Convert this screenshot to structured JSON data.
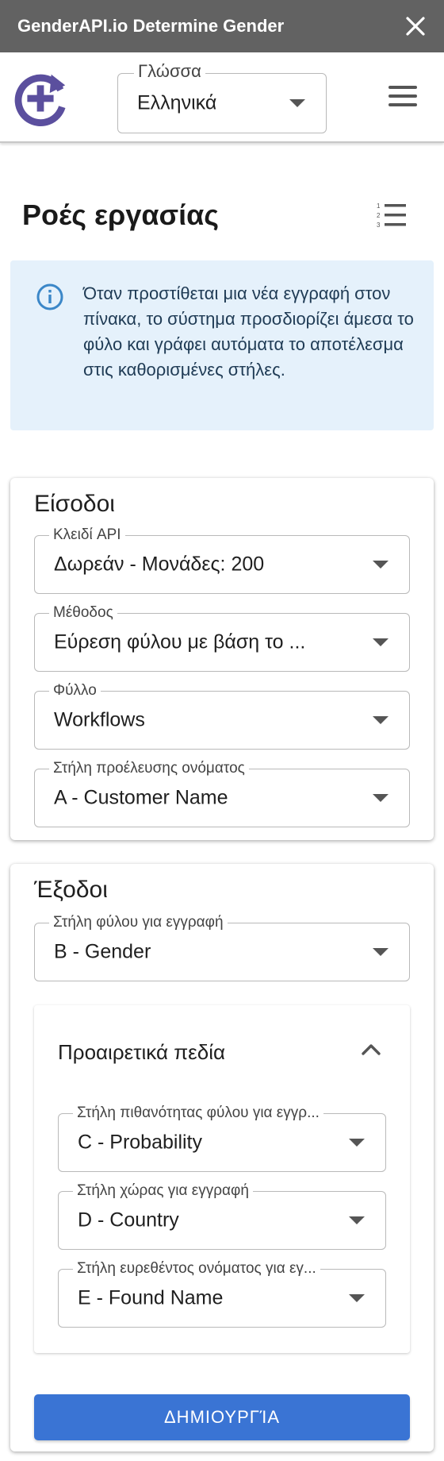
{
  "window": {
    "title": "GenderAPI.io Determine Gender"
  },
  "header": {
    "language_label": "Γλώσσα",
    "language_value": "Ελληνικά"
  },
  "page": {
    "title": "Ροές εργασίας"
  },
  "info": {
    "text": "Όταν προστίθεται μια νέα εγγραφή στον πίνακα, το σύστημα προσδιορίζει άμεσα το φύλο και γράφει αυτόματα το αποτέλεσμα στις καθορισμένες στήλες."
  },
  "inputs": {
    "title": "Είσοδοι",
    "api_key": {
      "label": "Κλειδί API",
      "value": "Δωρεάν - Μονάδες: 200"
    },
    "method": {
      "label": "Μέθοδος",
      "value": "Εύρεση φύλου με βάση το ..."
    },
    "sheet": {
      "label": "Φύλλο",
      "value": "Workflows"
    },
    "name_column": {
      "label": "Στήλη προέλευσης ονόματος",
      "value": "A - Customer Name"
    }
  },
  "outputs": {
    "title": "Έξοδοι",
    "gender_column": {
      "label": "Στήλη φύλου για εγγραφή",
      "value": "B - Gender"
    },
    "optional": {
      "title": "Προαιρετικά πεδία",
      "probability_column": {
        "label": "Στήλη πιθανότητας φύλου για εγγρ...",
        "value": "C - Probability"
      },
      "country_column": {
        "label": "Στήλη χώρας για εγγραφή",
        "value": "D - Country"
      },
      "found_name_column": {
        "label": "Στήλη ευρεθέντος ονόματος για εγ...",
        "value": "E - Found Name"
      }
    }
  },
  "actions": {
    "create_label": "ΔΗΜΙΟΥΡΓΊΑ"
  },
  "colors": {
    "accent": "#3a74d4",
    "logo": "#5b4f9e",
    "titlebar": "#626262",
    "info_bg": "#e5f1fb"
  }
}
